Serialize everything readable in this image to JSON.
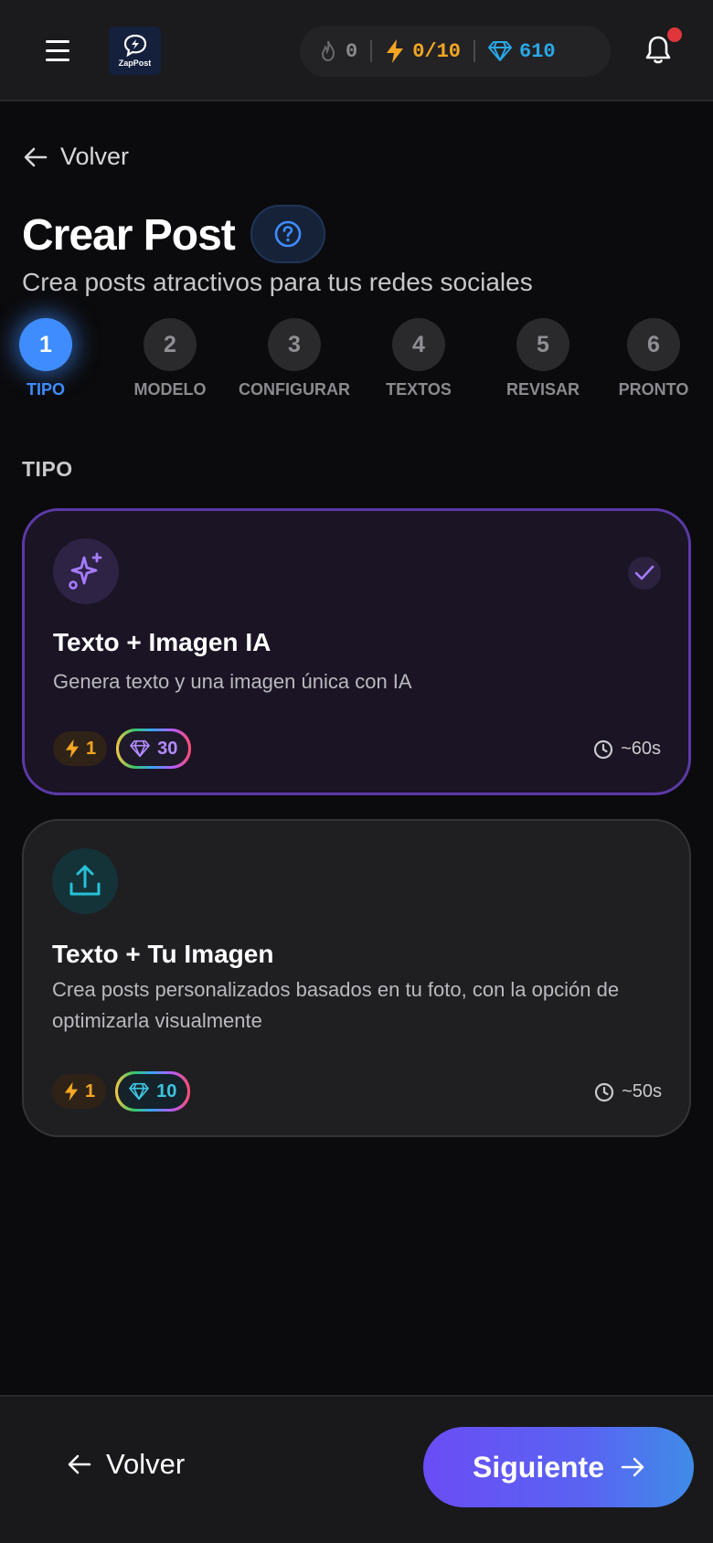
{
  "header": {
    "logo_text": "ZapPost",
    "streak": "0",
    "energy": "0/10",
    "gems": "610"
  },
  "nav": {
    "back_label": "Volver"
  },
  "page": {
    "title": "Crear Post",
    "subtitle": "Crea posts atractivos para tus redes sociales"
  },
  "steps": [
    {
      "number": "1",
      "label": "TIPO",
      "active": true
    },
    {
      "number": "2",
      "label": "MODELO"
    },
    {
      "number": "3",
      "label": "CONFIGURAR"
    },
    {
      "number": "4",
      "label": "TEXTOS"
    },
    {
      "number": "5",
      "label": "REVISAR"
    },
    {
      "number": "6",
      "label": "PRONTO"
    }
  ],
  "section_label": "TIPO",
  "options": [
    {
      "title": "Texto + Imagen IA",
      "description": "Genera texto y una imagen única con IA",
      "energy_cost": "1",
      "gem_cost": "30",
      "time": "~60s",
      "selected": true,
      "icon": "sparkles-icon"
    },
    {
      "title": "Texto + Tu Imagen",
      "description": "Crea posts personalizados basados en tu foto, con la opción de optimizarla visualmente",
      "energy_cost": "1",
      "gem_cost": "10",
      "time": "~50s",
      "selected": false,
      "icon": "upload-icon"
    }
  ],
  "footer": {
    "back_label": "Volver",
    "next_label": "Siguiente"
  },
  "colors": {
    "accent_blue": "#3f8cff",
    "selected_border": "#5b3aa8",
    "energy": "#f5a623",
    "gem": "#2aa8e8"
  }
}
